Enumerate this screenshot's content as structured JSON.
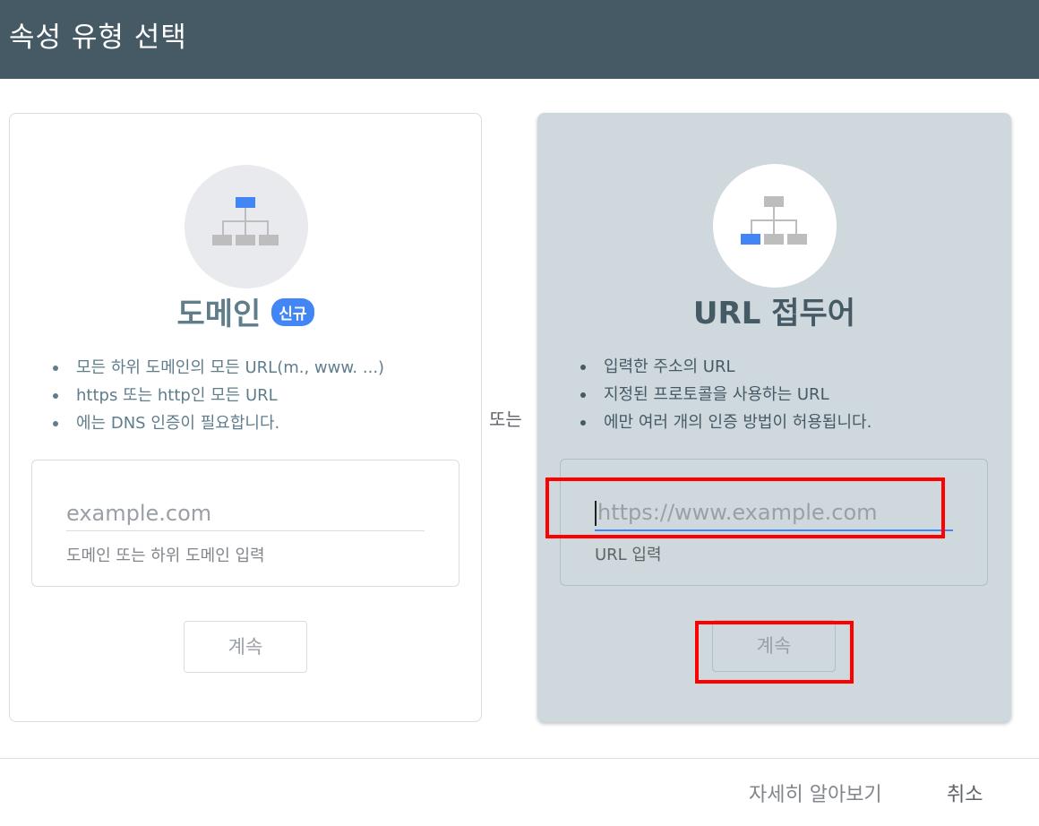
{
  "header": {
    "title": "속성 유형 선택"
  },
  "domain_card": {
    "title": "도메인",
    "badge": "신규",
    "bullets": [
      "모든 하위 도메인의 모든 URL(m., www. ...)",
      "https 또는 http인 모든 URL",
      "에는 DNS 인증이 필요합니다."
    ],
    "input_placeholder": "example.com",
    "input_hint": "도메인 또는 하위 도메인 입력",
    "continue_label": "계속",
    "icon": "sitemap-top-highlight-icon"
  },
  "separator": {
    "label": "또는"
  },
  "url_card": {
    "title": "URL 접두어",
    "bullets": [
      "입력한 주소의 URL",
      "지정된 프로토콜을 사용하는 URL",
      "에만 여러 개의 인증 방법이 허용됩니다."
    ],
    "input_placeholder": "https://www.example.com",
    "input_hint": "URL 입력",
    "continue_label": "계속",
    "icon": "sitemap-leaf-highlight-icon"
  },
  "footer": {
    "learn_more": "자세히 알아보기",
    "cancel": "취소"
  },
  "colors": {
    "header_bg": "#455a64",
    "accent_blue": "#4285f4",
    "selected_card_bg": "#cfd8dc",
    "annotation_red": "#ff0000"
  }
}
